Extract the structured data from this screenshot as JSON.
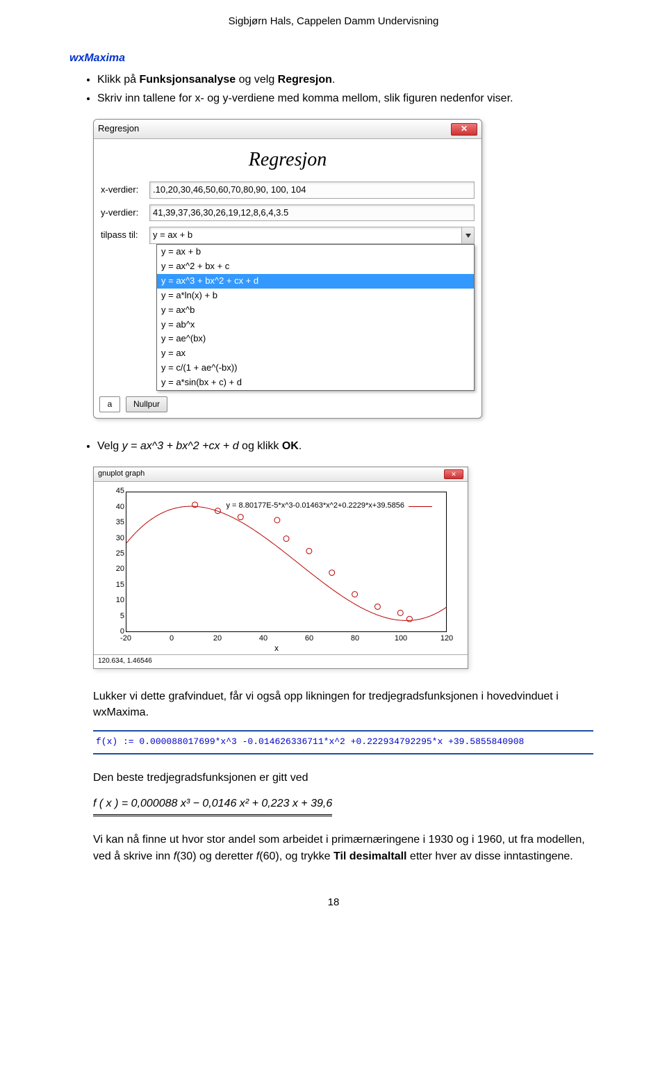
{
  "header": {
    "author_line": "Sigbjørn Hals, Cappelen Damm Undervisning"
  },
  "section": {
    "title": "wxMaxima"
  },
  "intro_bullets": [
    {
      "prefix": "Klikk på ",
      "b1": "Funksjonsanalyse",
      "mid": " og velg ",
      "b2": "Regresjon",
      "suffix": "."
    },
    {
      "line2": "Skriv inn tallene for x- og y-verdiene med komma mellom, slik figuren nedenfor viser."
    }
  ],
  "dialog": {
    "title": "Regresjon",
    "banner": "Regresjon",
    "labels": {
      "x": "x-verdier:",
      "y": "y-verdier:",
      "fit": "tilpass til:"
    },
    "x_value": ".10,20,30,46,50,60,70,80,90, 100, 104",
    "y_value": "41,39,37,36,30,26,19,12,8,6,4,3.5",
    "fit_selected": "y = ax + b",
    "options": [
      "y = ax + b",
      "y = ax^2 + bx + c",
      "y = ax^3 + bx^2 + cx + d",
      "y = a*ln(x) + b",
      "y = ax^b",
      "y = ab^x",
      "y = ae^(bx)",
      "y = ax",
      "y = c/(1 + ae^(-bx))",
      "y = a*sin(bx + c) + d"
    ],
    "highlight_index": 2,
    "buttons": {
      "nullpur": "Nullpur",
      "a": "a"
    }
  },
  "mid_bullet": {
    "prefix": "Velg ",
    "ital": "y = ax^3 + bx^2 +cx + d",
    "mid": " og klikk ",
    "bold": "OK",
    "suffix": "."
  },
  "plot": {
    "title": "gnuplot graph",
    "legend": "y = 8.80177E-5*x^3-0.01463*x^2+0.2229*x+39.5856",
    "y_ticks": [
      "45",
      "40",
      "35",
      "30",
      "25",
      "20",
      "15",
      "10",
      "5",
      "0"
    ],
    "x_ticks": [
      "-20",
      "0",
      "20",
      "40",
      "60",
      "80",
      "100",
      "120"
    ],
    "x_label": "x",
    "status": "120.634, 1.46546"
  },
  "after_plot_para": "Lukker vi dette grafvinduet, får vi også opp likningen for tredjegradsfunksjonen i hovedvinduet i wxMaxima.",
  "codebox": "f(x) := 0.000088017699*x^3 -0.014626336711*x^2 +0.222934792295*x +39.5855840908",
  "best_fit_intro": "Den beste tredjegradsfunksjonen er gitt ved",
  "formula_plain": "f ( x ) = 0,000088 x³ − 0,0146 x² + 0,223 x + 39,6",
  "closing_para": "Vi kan nå finne ut hvor stor andel som arbeidet i primærnæringene i 1930 og i 1960, ut fra modellen, ved å skrive inn f(30) og deretter f(60), og trykke Til desimaltall etter hver av disse inntastingene.",
  "page_number": "18",
  "chart_data": {
    "type": "scatter",
    "title": "y = 8.80177E-5*x^3-0.01463*x^2+0.2229*x+39.5856",
    "xlabel": "x",
    "ylabel": "",
    "xlim": [
      -20,
      120
    ],
    "ylim": [
      0,
      45
    ],
    "series": [
      {
        "name": "data",
        "x": [
          10,
          20,
          30,
          46,
          50,
          60,
          70,
          80,
          90,
          100,
          104
        ],
        "y": [
          41,
          39,
          37,
          36,
          30,
          26,
          19,
          12,
          8,
          6,
          4
        ]
      },
      {
        "name": "fit",
        "type": "line",
        "equation": "8.80177e-5*x^3 - 0.01463*x^2 + 0.2229*x + 39.5856"
      }
    ]
  }
}
